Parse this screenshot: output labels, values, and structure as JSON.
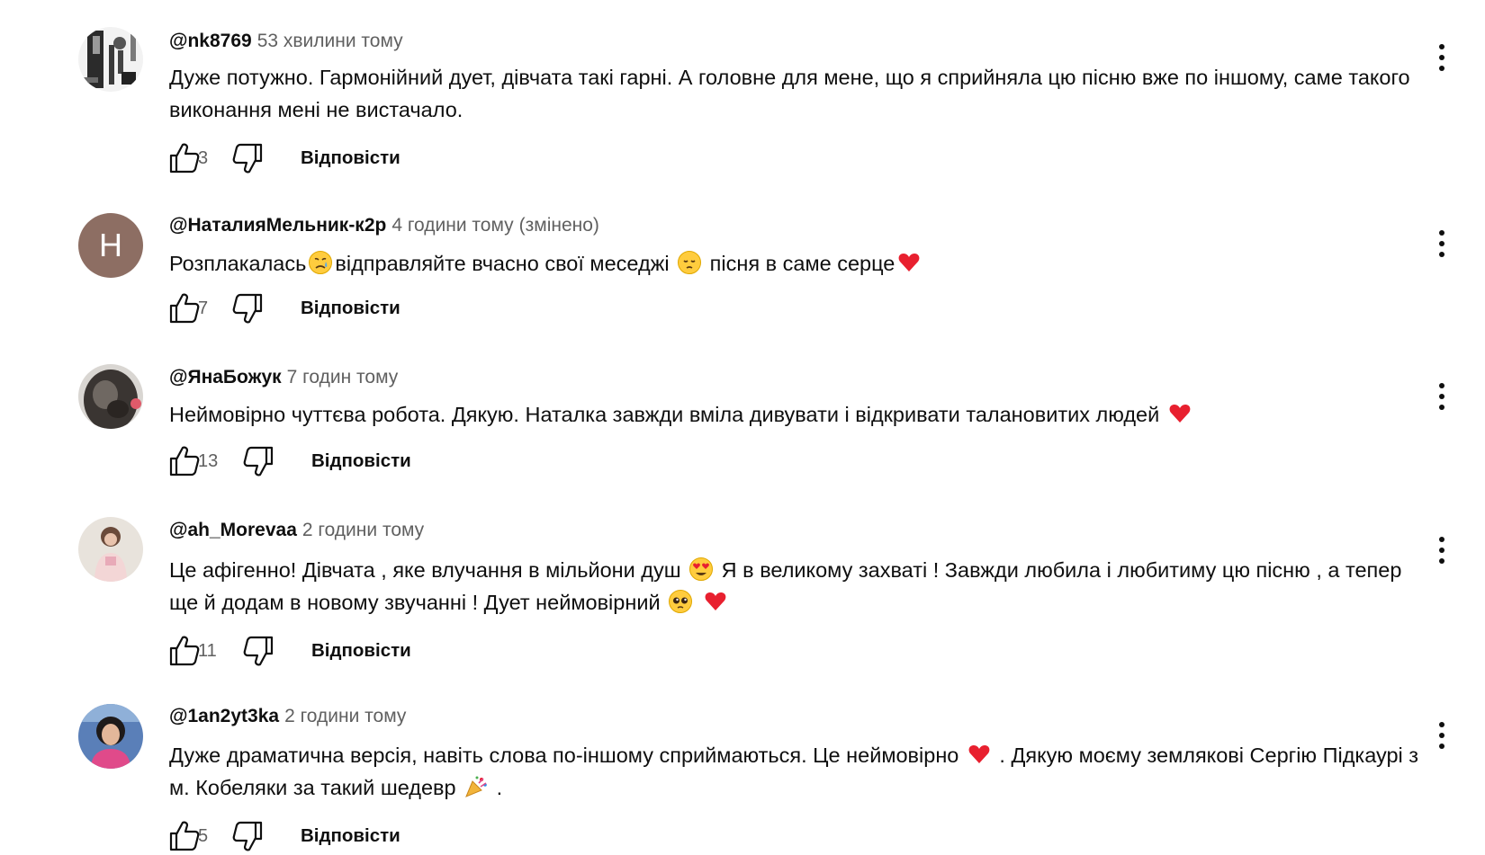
{
  "reply_label": "Відповісти",
  "comments": [
    {
      "author": "@nk8769",
      "time": "53 хвилини тому",
      "edited": "",
      "likes": "3",
      "avatar": {
        "type": "photo",
        "colors": [
          "#ffffff",
          "#2b2b2b",
          "#7a7a7a"
        ]
      },
      "text_parts": [
        "Дуже потужно. Гармонійний дует, дівчата такі гарні. А головне для мене, що я сприйняла цю пісню вже по іншому, саме такого виконання мені не вистачало."
      ]
    },
    {
      "author": "@НаталияМельник-к2р",
      "time": "4 години тому",
      "edited": "(змінено)",
      "likes": "7",
      "avatar": {
        "type": "letter",
        "letter": "Н",
        "color": "#8d6e63"
      },
      "text_parts": [
        "Розплакалась",
        "відправляйте вчасно свої меседжі ",
        " пісня в саме серце"
      ]
    },
    {
      "author": "@ЯнаБожук",
      "time": "7 годин тому",
      "edited": "",
      "likes": "13",
      "avatar": {
        "type": "photo",
        "colors": [
          "#d9d6d2",
          "#3a3532",
          "#6f6862"
        ]
      },
      "text_parts": [
        "Неймовірно чуттєва робота. Дякую. Наталка завжди вміла дивувати і відкривати талановитих людей "
      ]
    },
    {
      "author": "@ah_Morevaa",
      "time": "2 години тому",
      "edited": "",
      "likes": "11",
      "avatar": {
        "type": "photo",
        "colors": [
          "#e8e3dc",
          "#6a4a3a",
          "#f3d6d6"
        ]
      },
      "text_parts": [
        "Це афігенно! Дівчата , яке влучання в мільйони душ ",
        " Я в великому захваті ! Завжди любила і любитиму цю пісню , а тепер ще й додам в новому звучанні ! Дует неймовірний ",
        " "
      ]
    },
    {
      "author": "@1an2yt3ka",
      "time": "2 години тому",
      "edited": "",
      "likes": "5",
      "avatar": {
        "type": "photo",
        "colors": [
          "#5a7fb8",
          "#1e1a1a",
          "#e04a8a"
        ]
      },
      "text_parts": [
        "Дуже драматична версія, навіть слова по-іншому сприймаються. Це неймовірно ",
        " . Дякую моєму землякові Сергію Підкаурі з м. Кобеляки за такий шедевр ",
        " ."
      ]
    }
  ],
  "icons": {
    "like": "thumbs-up-outline-icon",
    "dislike": "thumbs-down-outline-icon",
    "menu": "more-vertical-icon",
    "emoji": [
      "crying-face-emoji",
      "pensive-face-emoji",
      "red-heart-emoji",
      "heart-eyes-emoji",
      "pleading-face-emoji",
      "party-popper-emoji"
    ]
  }
}
